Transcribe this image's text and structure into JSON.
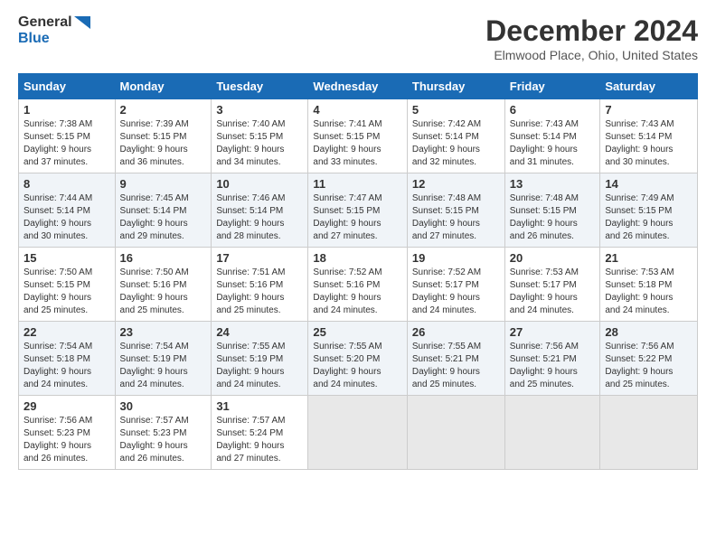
{
  "header": {
    "logo_line1": "General",
    "logo_line2": "Blue",
    "title": "December 2024",
    "location": "Elmwood Place, Ohio, United States"
  },
  "days_of_week": [
    "Sunday",
    "Monday",
    "Tuesday",
    "Wednesday",
    "Thursday",
    "Friday",
    "Saturday"
  ],
  "weeks": [
    [
      {
        "day": "1",
        "info": "Sunrise: 7:38 AM\nSunset: 5:15 PM\nDaylight: 9 hours\nand 37 minutes."
      },
      {
        "day": "2",
        "info": "Sunrise: 7:39 AM\nSunset: 5:15 PM\nDaylight: 9 hours\nand 36 minutes."
      },
      {
        "day": "3",
        "info": "Sunrise: 7:40 AM\nSunset: 5:15 PM\nDaylight: 9 hours\nand 34 minutes."
      },
      {
        "day": "4",
        "info": "Sunrise: 7:41 AM\nSunset: 5:15 PM\nDaylight: 9 hours\nand 33 minutes."
      },
      {
        "day": "5",
        "info": "Sunrise: 7:42 AM\nSunset: 5:14 PM\nDaylight: 9 hours\nand 32 minutes."
      },
      {
        "day": "6",
        "info": "Sunrise: 7:43 AM\nSunset: 5:14 PM\nDaylight: 9 hours\nand 31 minutes."
      },
      {
        "day": "7",
        "info": "Sunrise: 7:43 AM\nSunset: 5:14 PM\nDaylight: 9 hours\nand 30 minutes."
      }
    ],
    [
      {
        "day": "8",
        "info": "Sunrise: 7:44 AM\nSunset: 5:14 PM\nDaylight: 9 hours\nand 30 minutes."
      },
      {
        "day": "9",
        "info": "Sunrise: 7:45 AM\nSunset: 5:14 PM\nDaylight: 9 hours\nand 29 minutes."
      },
      {
        "day": "10",
        "info": "Sunrise: 7:46 AM\nSunset: 5:14 PM\nDaylight: 9 hours\nand 28 minutes."
      },
      {
        "day": "11",
        "info": "Sunrise: 7:47 AM\nSunset: 5:15 PM\nDaylight: 9 hours\nand 27 minutes."
      },
      {
        "day": "12",
        "info": "Sunrise: 7:48 AM\nSunset: 5:15 PM\nDaylight: 9 hours\nand 27 minutes."
      },
      {
        "day": "13",
        "info": "Sunrise: 7:48 AM\nSunset: 5:15 PM\nDaylight: 9 hours\nand 26 minutes."
      },
      {
        "day": "14",
        "info": "Sunrise: 7:49 AM\nSunset: 5:15 PM\nDaylight: 9 hours\nand 26 minutes."
      }
    ],
    [
      {
        "day": "15",
        "info": "Sunrise: 7:50 AM\nSunset: 5:15 PM\nDaylight: 9 hours\nand 25 minutes."
      },
      {
        "day": "16",
        "info": "Sunrise: 7:50 AM\nSunset: 5:16 PM\nDaylight: 9 hours\nand 25 minutes."
      },
      {
        "day": "17",
        "info": "Sunrise: 7:51 AM\nSunset: 5:16 PM\nDaylight: 9 hours\nand 25 minutes."
      },
      {
        "day": "18",
        "info": "Sunrise: 7:52 AM\nSunset: 5:16 PM\nDaylight: 9 hours\nand 24 minutes."
      },
      {
        "day": "19",
        "info": "Sunrise: 7:52 AM\nSunset: 5:17 PM\nDaylight: 9 hours\nand 24 minutes."
      },
      {
        "day": "20",
        "info": "Sunrise: 7:53 AM\nSunset: 5:17 PM\nDaylight: 9 hours\nand 24 minutes."
      },
      {
        "day": "21",
        "info": "Sunrise: 7:53 AM\nSunset: 5:18 PM\nDaylight: 9 hours\nand 24 minutes."
      }
    ],
    [
      {
        "day": "22",
        "info": "Sunrise: 7:54 AM\nSunset: 5:18 PM\nDaylight: 9 hours\nand 24 minutes."
      },
      {
        "day": "23",
        "info": "Sunrise: 7:54 AM\nSunset: 5:19 PM\nDaylight: 9 hours\nand 24 minutes."
      },
      {
        "day": "24",
        "info": "Sunrise: 7:55 AM\nSunset: 5:19 PM\nDaylight: 9 hours\nand 24 minutes."
      },
      {
        "day": "25",
        "info": "Sunrise: 7:55 AM\nSunset: 5:20 PM\nDaylight: 9 hours\nand 24 minutes."
      },
      {
        "day": "26",
        "info": "Sunrise: 7:55 AM\nSunset: 5:21 PM\nDaylight: 9 hours\nand 25 minutes."
      },
      {
        "day": "27",
        "info": "Sunrise: 7:56 AM\nSunset: 5:21 PM\nDaylight: 9 hours\nand 25 minutes."
      },
      {
        "day": "28",
        "info": "Sunrise: 7:56 AM\nSunset: 5:22 PM\nDaylight: 9 hours\nand 25 minutes."
      }
    ],
    [
      {
        "day": "29",
        "info": "Sunrise: 7:56 AM\nSunset: 5:23 PM\nDaylight: 9 hours\nand 26 minutes."
      },
      {
        "day": "30",
        "info": "Sunrise: 7:57 AM\nSunset: 5:23 PM\nDaylight: 9 hours\nand 26 minutes."
      },
      {
        "day": "31",
        "info": "Sunrise: 7:57 AM\nSunset: 5:24 PM\nDaylight: 9 hours\nand 27 minutes."
      },
      {
        "day": "",
        "info": ""
      },
      {
        "day": "",
        "info": ""
      },
      {
        "day": "",
        "info": ""
      },
      {
        "day": "",
        "info": ""
      }
    ]
  ]
}
